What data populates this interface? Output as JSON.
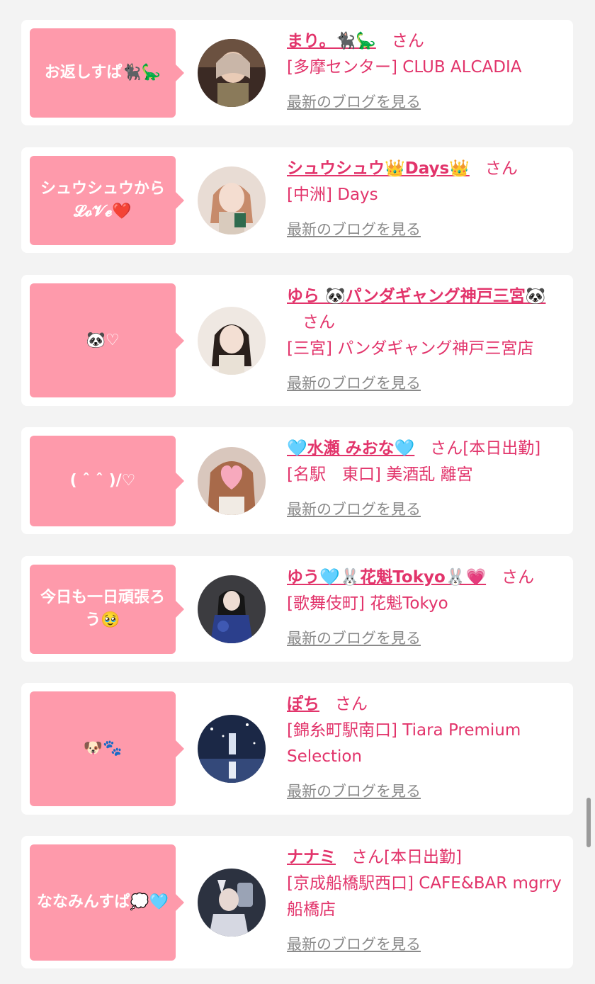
{
  "colors": {
    "accent": "#e2346b",
    "bubble": "#fe9aab",
    "link_gray": "#8a8a8a"
  },
  "san_label": "さん",
  "blog_link_label": "最新のブログを見る",
  "cards": [
    {
      "bubble": "お返しすぱ🐈‍⬛🦕",
      "name": "まり。🐈‍⬛🦕",
      "suffix": "さん",
      "shop": "[多摩センター] CLUB ALCADIA",
      "blog": "最新のブログを見る"
    },
    {
      "bubble": "シュウシュウから𝓛𝓸𝓥𝓮❤️",
      "name": "シュウシュウ👑Days👑",
      "suffix": "さん",
      "shop": "[中洲] Days",
      "blog": "最新のブログを見る"
    },
    {
      "bubble": "🐼♡",
      "name": "ゆら 🐼パンダギャング神戸三宮🐼",
      "suffix": "さん",
      "shop": "[三宮] パンダギャング神戸三宮店",
      "blog": "最新のブログを見る"
    },
    {
      "bubble": "( ˆ ˆ )/♡",
      "name": "🩵水瀬 みおな🩵",
      "suffix": "さん[本日出勤]",
      "shop": "[名駅　東口] 美酒乱 離宮",
      "blog": "最新のブログを見る"
    },
    {
      "bubble": "今日も一日頑張ろう🥹",
      "name": "ゆう🩵🐰花魁Tokyo🐰💗",
      "suffix": "さん",
      "shop": "[歌舞伎町] 花魁Tokyo",
      "blog": "最新のブログを見る"
    },
    {
      "bubble": "🐶🐾",
      "name": "ぽち",
      "suffix": "さん",
      "shop": "[錦糸町駅南口] Tiara Premium Selection",
      "blog": "最新のブログを見る"
    },
    {
      "bubble": "ななみんすぱ💭🩵",
      "name": "ナナミ",
      "suffix": "さん[本日出勤]",
      "shop": "[京成船橋駅西口] CAFE&BAR mgrry 船橋店",
      "blog": "最新のブログを見る"
    }
  ]
}
